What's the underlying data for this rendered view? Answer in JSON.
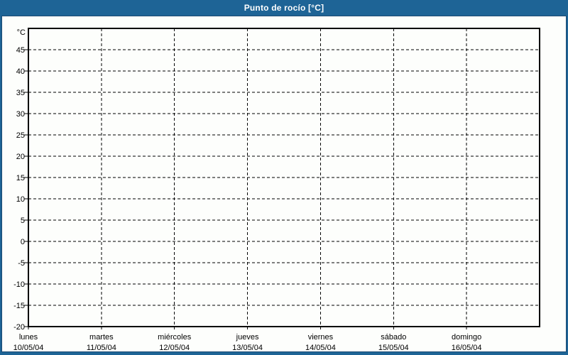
{
  "window": {
    "title": "Punto de rocío [°C]"
  },
  "theme": {
    "titlebar_color": "#1e6496",
    "frame_border_color": "#1e6496",
    "frame_inner_line_color": "#1c4a73",
    "surface_color": "#fdfefc",
    "grid_color": "#000000",
    "axis_color": "#000000",
    "text_color": "#000000",
    "title_text_color": "#ffffff"
  },
  "chart_data": {
    "type": "line",
    "title": "Punto de rocío [°C]",
    "ylabel": "°C",
    "xlabel": "",
    "ylim": [
      -20,
      50
    ],
    "ytick_step": 5,
    "yticks": [
      45,
      40,
      35,
      30,
      25,
      20,
      15,
      10,
      5,
      0,
      -5,
      -10,
      -15,
      -20
    ],
    "grid": "dashed",
    "legend": "none",
    "categories": [
      {
        "name": "lunes",
        "date": "10/05/04"
      },
      {
        "name": "martes",
        "date": "11/05/04"
      },
      {
        "name": "miércoles",
        "date": "12/05/04"
      },
      {
        "name": "jueves",
        "date": "13/05/04"
      },
      {
        "name": "viernes",
        "date": "14/05/04"
      },
      {
        "name": "sábado",
        "date": "15/05/04"
      },
      {
        "name": "domingo",
        "date": "16/05/04"
      }
    ],
    "series": []
  }
}
